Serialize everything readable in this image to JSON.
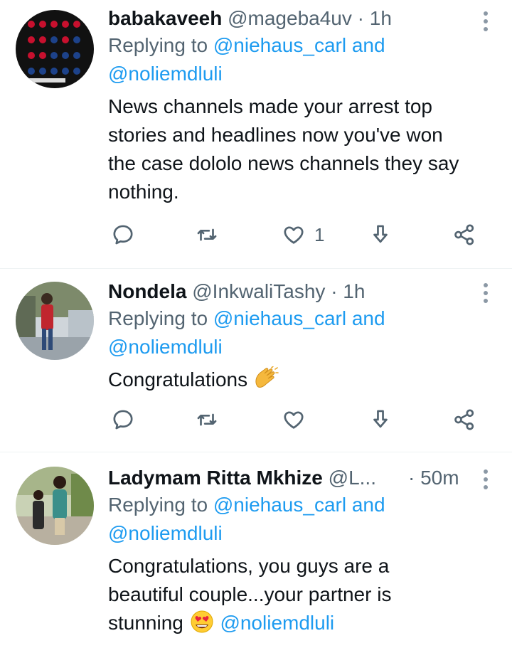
{
  "tweets": [
    {
      "name": "babakaveeh",
      "handle": "@mageba4uv",
      "time": "1h",
      "replying_to": "Replying to",
      "mention1": "@niehaus_carl",
      "and": "and",
      "mention2": "@noliemdluli",
      "text_lines": [
        "News channels made your arrest top",
        "stories and headlines now you've won",
        "the case dololo news channels they say",
        "nothing."
      ],
      "like_count": "1"
    },
    {
      "name": "Nondela",
      "handle": "@InkwaliTashy",
      "time": "1h",
      "replying_to": "Replying to",
      "mention1": "@niehaus_carl",
      "and": "and",
      "mention2": "@noliemdluli",
      "text": "Congratulations",
      "emoji": "clapping-hands-emoji"
    },
    {
      "name": "Ladymam Ritta Mkhize",
      "handle": "@L...",
      "time": "50m",
      "replying_to": "Replying to",
      "mention1": "@niehaus_carl",
      "and": "and",
      "mention2": "@noliemdluli",
      "text_lines": [
        "Congratulations,  you guys are a",
        "beautiful couple...your partner is",
        "stunning"
      ],
      "text_mention": "@noliemdluli",
      "emoji": "heart-eyes-emoji"
    }
  ],
  "colors": {
    "accent": "#1d9bf0",
    "secondary": "#536471",
    "primary": "#0f1419",
    "divider": "#eff3f4"
  },
  "icons": [
    "reply-icon",
    "retweet-icon",
    "like-icon",
    "bookmark-icon",
    "share-icon",
    "more-icon"
  ]
}
